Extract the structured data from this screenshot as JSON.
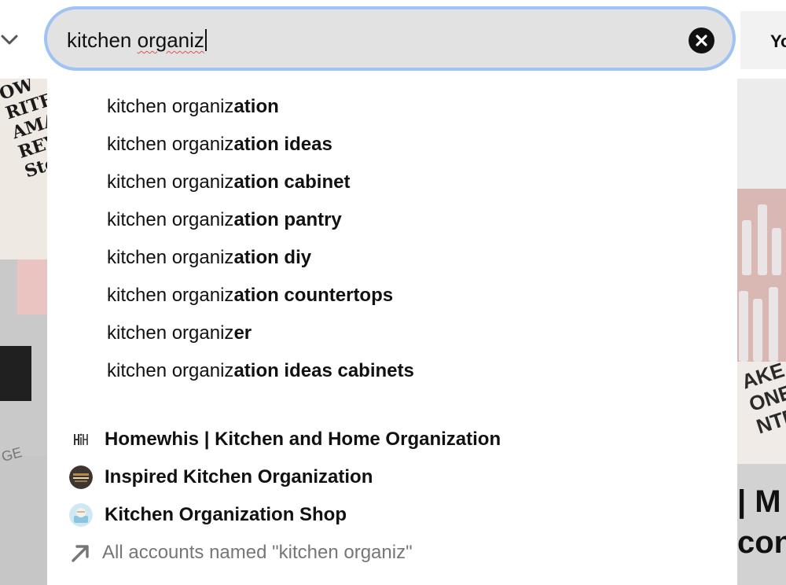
{
  "search": {
    "query": "kitchen organiz",
    "query_prefix": "kitchen ",
    "query_word": "organiz"
  },
  "header": {
    "right_label": "Yo"
  },
  "suggestions": [
    {
      "prefix": "kitchen organiz",
      "completion": "ation"
    },
    {
      "prefix": "kitchen organiz",
      "completion": "ation ideas"
    },
    {
      "prefix": "kitchen organiz",
      "completion": "ation cabinet"
    },
    {
      "prefix": "kitchen organiz",
      "completion": "ation pantry"
    },
    {
      "prefix": "kitchen organiz",
      "completion": "ation diy"
    },
    {
      "prefix": "kitchen organiz",
      "completion": "ation countertops"
    },
    {
      "prefix": "kitchen organiz",
      "completion": "er"
    },
    {
      "prefix": "kitchen organiz",
      "completion": "ation ideas cabinets"
    }
  ],
  "accounts": [
    {
      "name": "Homewhis | Kitchen and Home Organization",
      "avatar": "homewhis-logo-icon"
    },
    {
      "name": "Inspired Kitchen Organization",
      "avatar": "inspired-kitchen-avatar"
    },
    {
      "name": "Kitchen Organization Shop",
      "avatar": "kitchen-shop-avatar"
    }
  ],
  "all_accounts_label": "All accounts named \"kitchen organiz\"",
  "background": {
    "left_pin_text": "OW\nRITE A\nAMAZO\nREV\nStep-",
    "left_tail_text": "GE",
    "right_pin_text": "AKE\nONEY\nNTER",
    "right_bottom_text": "| M\ncon"
  },
  "colors": {
    "focus_ring": "#9fc3f2",
    "search_bg": "#e2e2e2",
    "text": "#111111",
    "muted": "#767676"
  }
}
